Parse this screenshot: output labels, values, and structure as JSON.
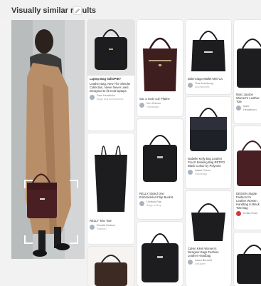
{
  "header": {
    "title": "Visually similar results"
  },
  "icons": {
    "edit": "pencil-icon"
  },
  "colors": {
    "header_bg": "#f1f1f1",
    "grid_bg": "#f2f2f2",
    "bag_black": "#1d1d1f",
    "bag_burgundy": "#4a1f24",
    "coat": "#b98f6a",
    "scarf": "#3a3a3a",
    "save_red": "#d33b3b"
  },
  "pins": {
    "p1": {
      "caption": "Leather Bag, New The Slender Collection, Never Never used. Designed to fit most laptops",
      "heading": "Laptop Bag ItaliOPIEY",
      "user": "Pam Hendricks",
      "board": "Bags and Accessories"
    },
    "p2": {
      "caption": "Sac a main cuir Platine",
      "user": "Kim Greene",
      "board": "Handbags"
    },
    "p3": {
      "caption": "Balenciaga Wallet Mini Ca",
      "user": "Tina Armstrong",
      "board": "Accessories"
    },
    "p4": {
      "caption": "Marc Jacobs Women's Leather Tote",
      "user": "Mark Henderson",
      "board": "Women's Fashion"
    },
    "p5": {
      "caption": "RELLY Styled One Embroidered Flap Bucket",
      "user": "Lindsey Rae",
      "board": "Bags to Buy"
    },
    "p6": {
      "caption": "Isabelle Kelly bag Leather Pouch Bowling Bag RETRO Black Colour by Polyrose",
      "user": "Isabel Flores",
      "board": "Handbags"
    },
    "p7": {
      "caption": "DESIGN Staple Fashion Pu Leather Women Handbag in Black Tote Bag",
      "user": "Emilia Rose",
      "board": "Bags"
    },
    "p8": {
      "caption": "RELLY Tote Tote",
      "user": "Ronald Hudson",
      "board": "Fashion"
    },
    "p9": {
      "caption": "Calvin Klein Women's Designer Bags Fashion Leather Handbag",
      "user": "Laura Bennett",
      "board": "Designer"
    },
    "p10": {
      "caption": "Furla Women's Leather Bag & Purse Black Moderna",
      "user": "Fashion & Accessories",
      "board": "Curated"
    }
  }
}
